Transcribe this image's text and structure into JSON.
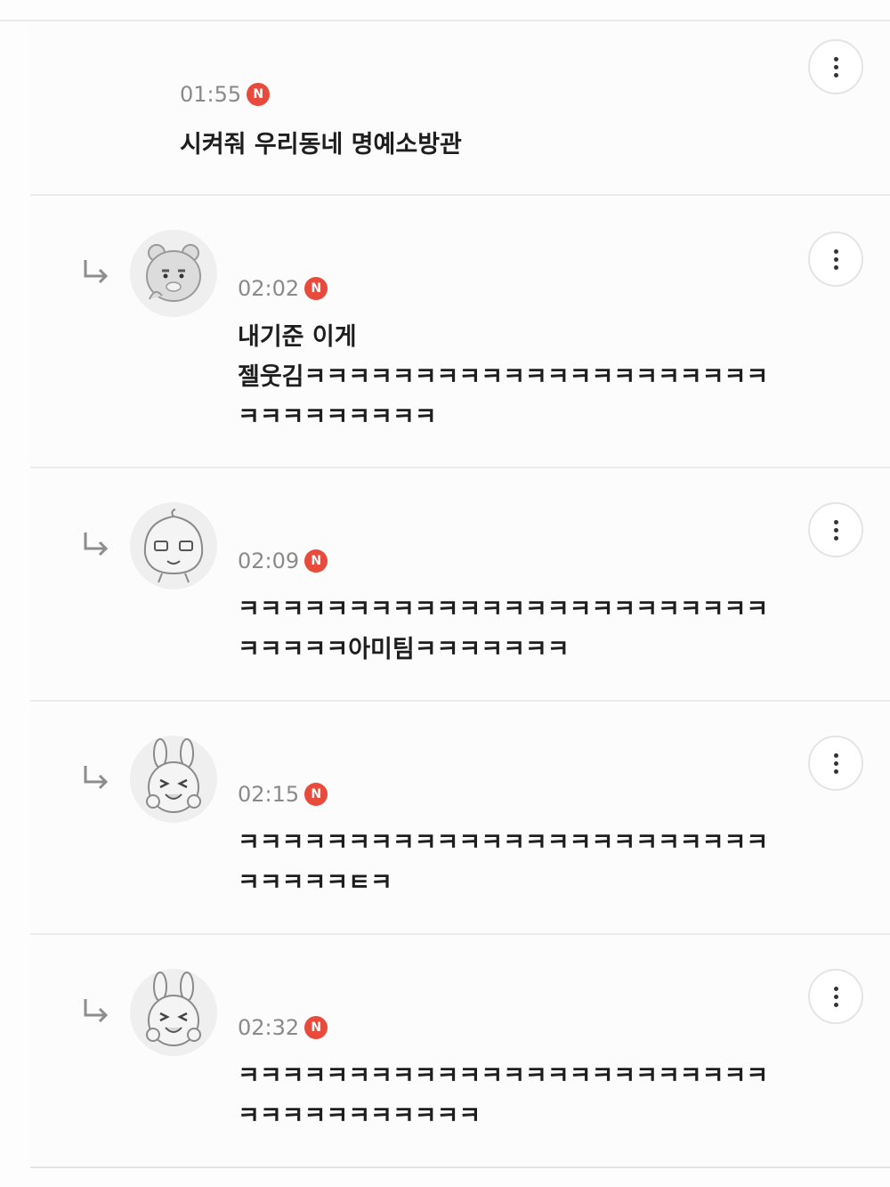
{
  "comments": [
    {
      "time": "01:55",
      "new_badge": "N",
      "text": "시켜줘 우리동네 명예소방관",
      "is_reply": false
    },
    {
      "time": "02:02",
      "new_badge": "N",
      "text": "내기준 이게\n젤웃김ㅋㅋㅋㅋㅋㅋㅋㅋㅋㅋㅋㅋㅋㅋㅋㅋㅋㅋㅋㅋㅋ\nㅋㅋㅋㅋㅋㅋㅋㅋㅋ",
      "is_reply": true,
      "avatar": "ryan-avatar"
    },
    {
      "time": "02:09",
      "new_badge": "N",
      "text": "ㅋㅋㅋㅋㅋㅋㅋㅋㅋㅋㅋㅋㅋㅋㅋㅋㅋㅋㅋㅋㅋㅋㅋㅋ\nㅋㅋㅋㅋㅋ아미팀ㅋㅋㅋㅋㅋㅋㅋ",
      "is_reply": true,
      "avatar": "apeach-avatar"
    },
    {
      "time": "02:15",
      "new_badge": "N",
      "text": "ㅋㅋㅋㅋㅋㅋㅋㅋㅋㅋㅋㅋㅋㅋㅋㅋㅋㅋㅋㅋㅋㅋㅋㅋ\nㅋㅋㅋㅋㅋㅌㅋ",
      "is_reply": true,
      "avatar": "muzi-avatar"
    },
    {
      "time": "02:32",
      "new_badge": "N",
      "text": "ㅋㅋㅋㅋㅋㅋㅋㅋㅋㅋㅋㅋㅋㅋㅋㅋㅋㅋㅋㅋㅋㅋㅋㅋ\nㅋㅋㅋㅋㅋㅋㅋㅋㅋㅋㅋ",
      "is_reply": true,
      "avatar": "muzi-avatar"
    }
  ],
  "icons": {
    "reply": "reply-arrow-icon",
    "more": "more-options-icon",
    "badge": "new-badge"
  },
  "colors": {
    "badge_red": "#e84a3c",
    "time_gray": "#8a8a8a",
    "divider": "#ebebeb"
  }
}
